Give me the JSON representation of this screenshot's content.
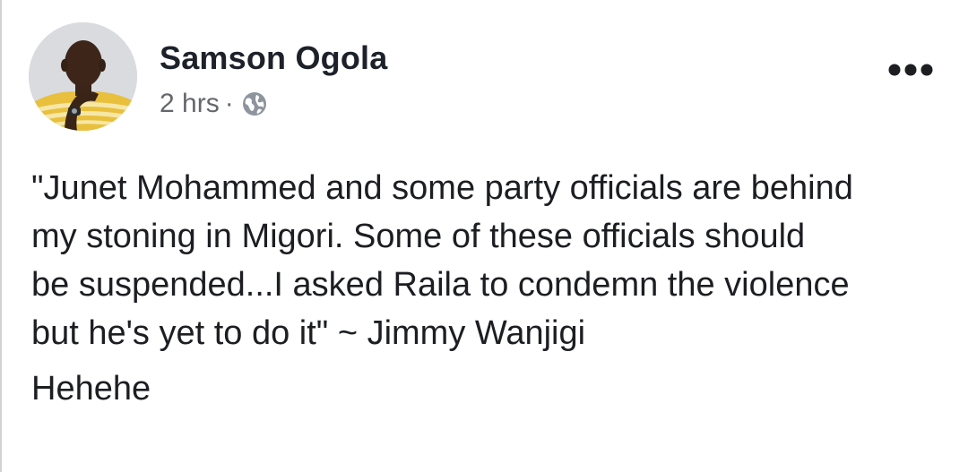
{
  "post": {
    "author_name": "Samson Ogola",
    "timestamp": "2 hrs",
    "meta_separator": "·",
    "privacy_icon": "globe-icon",
    "more_icon": "more-options-icon",
    "body_lines": [
      "\"Junet Mohammed and some party officials are behind",
      "my stoning in Migori. Some of these officials should",
      "be suspended...I asked Raila to condemn the violence",
      "but he's yet to do it\" ~ Jimmy Wanjigi"
    ],
    "body_second_paragraph": "Hehehe"
  },
  "colors": {
    "author": "#1d2129",
    "meta": "#65676b",
    "body": "#1c1e21",
    "border": "#d0d2d6"
  }
}
